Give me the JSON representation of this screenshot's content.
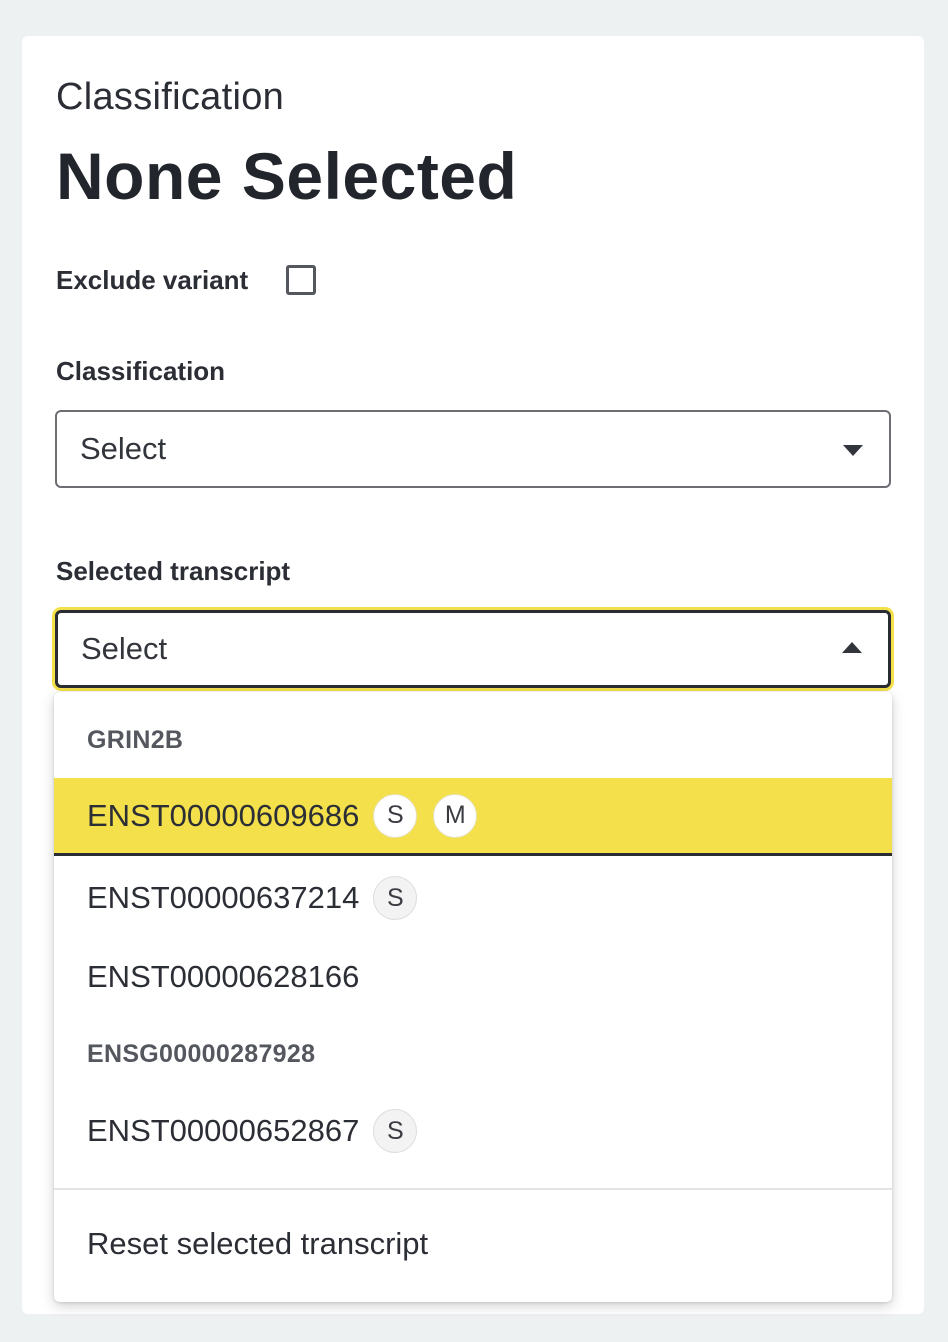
{
  "header": {
    "eyebrow": "Classification",
    "title": "None Selected"
  },
  "exclude": {
    "label": "Exclude variant",
    "checked": false
  },
  "classification": {
    "label": "Classification",
    "value": "Select"
  },
  "transcript": {
    "label": "Selected transcript",
    "value": "Select",
    "groups": [
      {
        "name": "GRIN2B",
        "options": [
          {
            "id": "ENST00000609686",
            "badges": [
              "S",
              "M"
            ],
            "highlighted": true
          },
          {
            "id": "ENST00000637214",
            "badges": [
              "S"
            ]
          },
          {
            "id": "ENST00000628166",
            "badges": []
          }
        ]
      },
      {
        "name": "ENSG00000287928",
        "options": [
          {
            "id": "ENST00000652867",
            "badges": [
              "S"
            ]
          }
        ]
      }
    ],
    "reset_label": "Reset selected transcript"
  },
  "colors": {
    "accent": "#f4e04b",
    "text": "#23252d",
    "background": "#eef1f2"
  }
}
